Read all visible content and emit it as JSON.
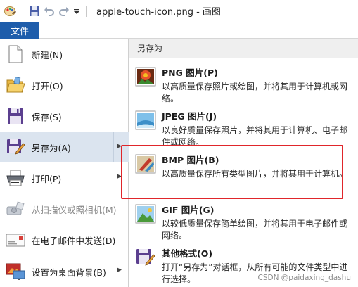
{
  "window": {
    "title": "apple-touch-icon.png - 画图"
  },
  "ribbon": {
    "file_tab": "文件"
  },
  "menu": {
    "items": [
      {
        "label": "新建(N)",
        "icon": "new-document-icon"
      },
      {
        "label": "打开(O)",
        "icon": "open-folder-icon"
      },
      {
        "label": "保存(S)",
        "icon": "save-icon"
      },
      {
        "label": "另存为(A)",
        "icon": "save-as-icon"
      },
      {
        "label": "打印(P)",
        "icon": "printer-icon"
      },
      {
        "label": "从扫描仪或照相机(M)",
        "icon": "scanner-icon"
      },
      {
        "label": "在电子邮件中发送(D)",
        "icon": "email-icon"
      },
      {
        "label": "设置为桌面背景(B)",
        "icon": "desktop-background-icon"
      }
    ]
  },
  "save_as_panel": {
    "header": "另存为",
    "options": [
      {
        "title": "PNG 图片(P)",
        "desc": "以高质量保存照片或绘图，并将其用于计算机或网络。",
        "icon": "png-image-icon"
      },
      {
        "title": "JPEG 图片(J)",
        "desc": "以良好质量保存照片，并将其用于计算机、电子邮件或网络。",
        "icon": "jpeg-image-icon"
      },
      {
        "title": "BMP 图片(B)",
        "desc": "以高质量保存所有类型图片，并将其用于计算机。",
        "icon": "bmp-image-icon"
      },
      {
        "title": "GIF 图片(G)",
        "desc": "以较低质量保存简单绘图，并将其用于电子邮件或网络。",
        "icon": "gif-image-icon"
      },
      {
        "title": "其他格式(O)",
        "desc": "打开“另存为”对话框，从所有可能的文件类型中进行选择。",
        "icon": "other-formats-icon"
      }
    ]
  },
  "watermark": "CSDN @paidaxing_dashu",
  "colors": {
    "file_tab": "#1e5dab",
    "active_item": "#dbe4ef",
    "highlight_border": "#e0262b"
  }
}
